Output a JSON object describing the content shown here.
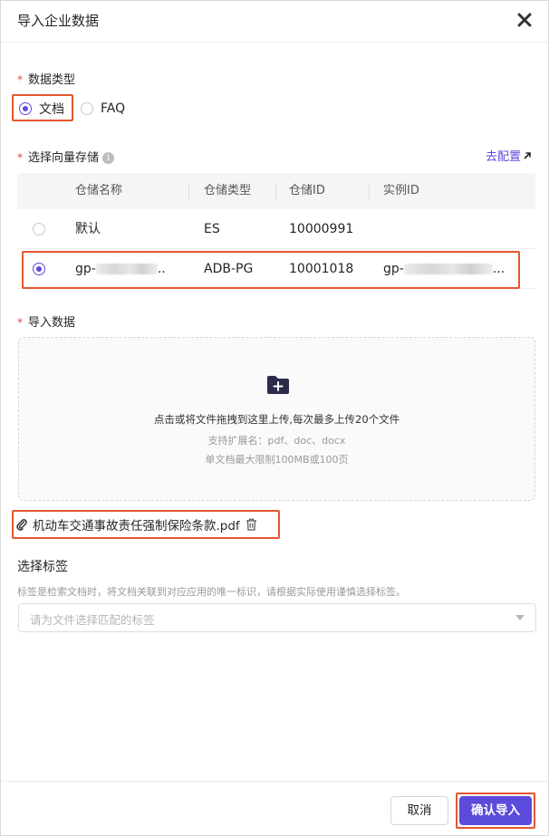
{
  "dialog": {
    "title": "导入企业数据",
    "close_label": "✕"
  },
  "data_type": {
    "label": "数据类型",
    "required_mark": "*",
    "options": [
      {
        "label": "文档",
        "checked": true
      },
      {
        "label": "FAQ",
        "checked": false
      }
    ]
  },
  "vector_store": {
    "label": "选择向量存储",
    "required_mark": "*",
    "info_icon": "i",
    "config_link": "去配置",
    "columns": [
      "仓储名称",
      "仓储类型",
      "仓储ID",
      "实例ID"
    ],
    "rows": [
      {
        "name": "默认",
        "type": "ES",
        "id": "10000991",
        "instance": "",
        "selected": false
      },
      {
        "name_prefix": "gp-",
        "name_suffix": "..",
        "type": "ADB-PG",
        "id": "10001018",
        "instance_prefix": "gp-",
        "instance_suffix": "...",
        "selected": true
      }
    ]
  },
  "import_data": {
    "label": "导入数据",
    "required_mark": "*",
    "dropzone_main": "点击或将文件拖拽到这里上传,每次最多上传20个文件",
    "dropzone_ext": "支持扩展名：pdf、doc、docx",
    "dropzone_limit": "单文档最大限制100MB或100页",
    "uploaded_file": "机动车交通事故责任强制保险条款.pdf"
  },
  "tags": {
    "title": "选择标签",
    "hint": "标签是检索文档时，将文档关联到对应应用的唯一标识，请根据实际使用谨慎选择标签。",
    "placeholder": "请为文件选择匹配的标签"
  },
  "footer": {
    "cancel_label": "取消",
    "confirm_label": "确认导入"
  },
  "colors": {
    "accent": "#5b4bdb",
    "highlight_box": "#e4572e",
    "required": "#e54545"
  }
}
